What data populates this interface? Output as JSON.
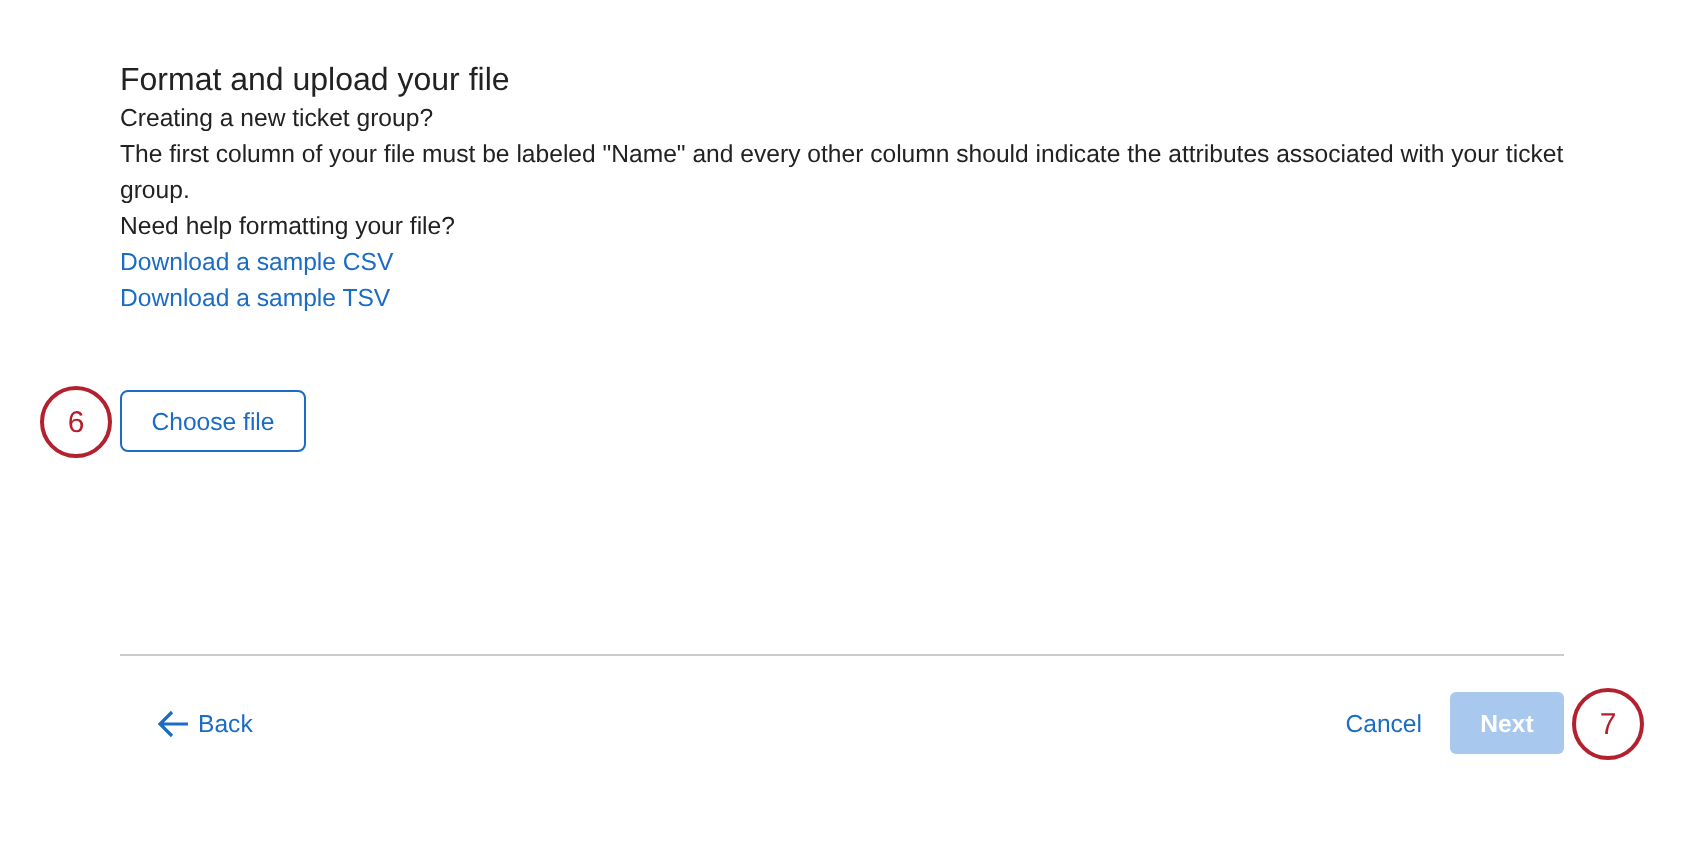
{
  "heading": "Format and upload your file",
  "lines": [
    "Creating a new ticket group?",
    "The first column of your file must be labeled \"Name\" and every other column should indicate the attributes associated with your ticket group.",
    "Need help formatting your file?"
  ],
  "links": [
    "Download a sample CSV",
    "Download a sample TSV"
  ],
  "choose_button": {
    "label": "Choose file",
    "callout": "6"
  },
  "footer": {
    "back": {
      "label": "Back"
    },
    "cancel": {
      "label": "Cancel"
    },
    "next": {
      "label": "Next",
      "disabled": true,
      "callout": "7"
    }
  }
}
